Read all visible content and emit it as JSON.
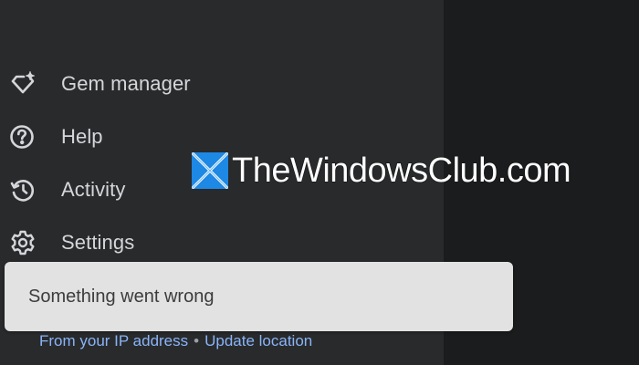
{
  "sidebar": {
    "items": [
      {
        "label": "Gem manager",
        "icon": "gem-sparkle-icon"
      },
      {
        "label": "Help",
        "icon": "help-circle-icon"
      },
      {
        "label": "Activity",
        "icon": "history-icon"
      },
      {
        "label": "Settings",
        "icon": "gear-icon"
      }
    ]
  },
  "toast": {
    "message": "Something went wrong"
  },
  "footer": {
    "ip_link": "From your IP address",
    "separator": "•",
    "update_link": "Update location"
  },
  "watermark": {
    "text": "TheWindowsClub.com"
  },
  "colors": {
    "sidebar_bg": "#282a2c",
    "main_bg": "#1b1c1d",
    "text": "#d4d6d9",
    "link": "#8ab4f8",
    "toast_bg": "#e2e2e2",
    "logo_blue": "#1e88e5"
  }
}
